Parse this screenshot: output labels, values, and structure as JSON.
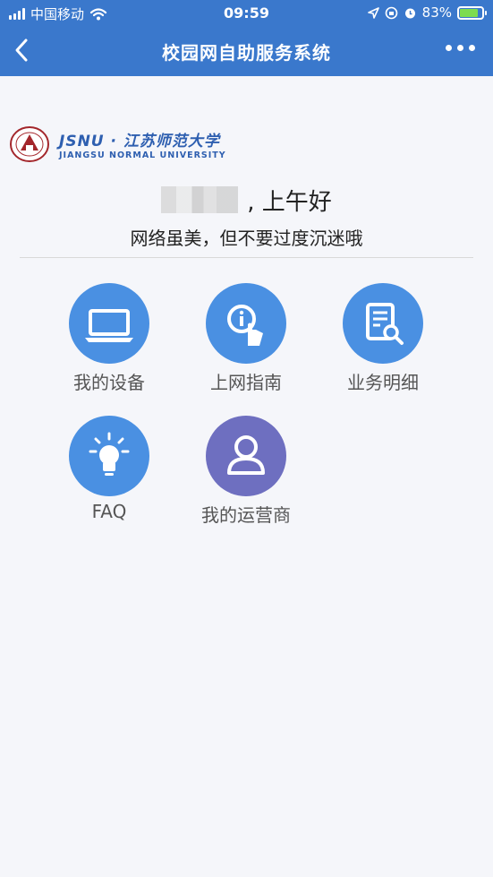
{
  "status": {
    "carrier": "中国移动",
    "time": "09:59",
    "battery": "83%",
    "battery_fraction": 0.83
  },
  "nav": {
    "title": "校园网自助服务系统"
  },
  "logo": {
    "short": "JSNU · 江苏师范大学",
    "full": "JIANGSU NORMAL UNIVERSITY"
  },
  "greeting": {
    "text": ", 上午好",
    "subtitle": "网络虽美，但不要过度沉迷哦"
  },
  "menu": [
    {
      "label": "我的设备",
      "icon": "laptop-icon"
    },
    {
      "label": "上网指南",
      "icon": "info-touch-icon"
    },
    {
      "label": "业务明细",
      "icon": "document-search-icon"
    },
    {
      "label": "FAQ",
      "icon": "lightbulb-icon"
    },
    {
      "label": "我的运营商",
      "icon": "user-icon"
    }
  ]
}
